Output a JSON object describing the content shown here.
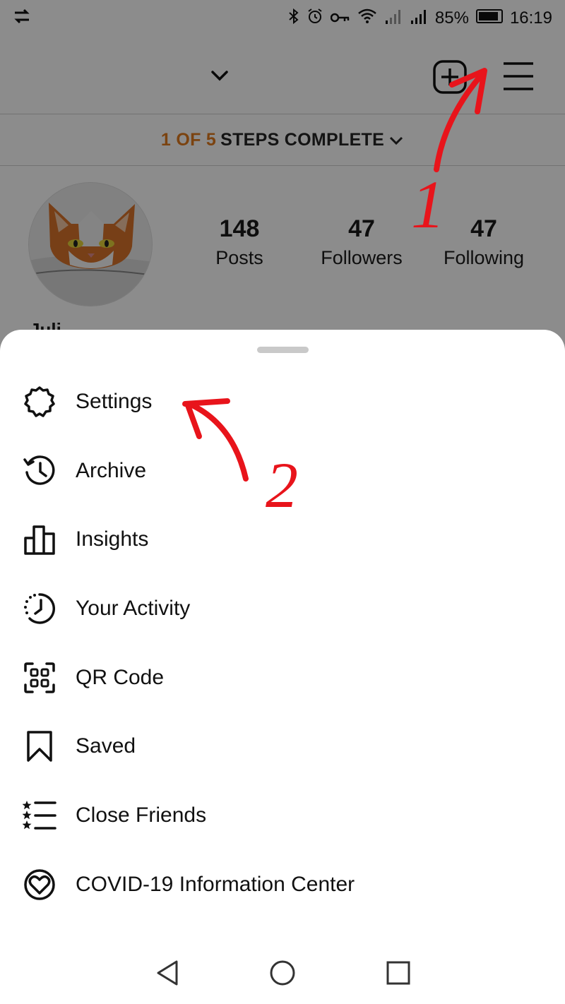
{
  "status_bar": {
    "battery": "85%",
    "time": "16:19"
  },
  "profile": {
    "steps_done": "1 OF 5",
    "steps_rest": "STEPS COMPLETE",
    "name_partial": "Juli",
    "stats": [
      {
        "value": "148",
        "label": "Posts"
      },
      {
        "value": "47",
        "label": "Followers"
      },
      {
        "value": "47",
        "label": "Following"
      }
    ]
  },
  "menu": {
    "items": [
      {
        "label": "Settings",
        "icon": "gear-icon"
      },
      {
        "label": "Archive",
        "icon": "archive-icon"
      },
      {
        "label": "Insights",
        "icon": "insights-icon"
      },
      {
        "label": "Your Activity",
        "icon": "activity-icon"
      },
      {
        "label": "QR Code",
        "icon": "qr-code-icon"
      },
      {
        "label": "Saved",
        "icon": "bookmark-icon"
      },
      {
        "label": "Close Friends",
        "icon": "close-friends-icon"
      },
      {
        "label": "COVID-19 Information Center",
        "icon": "covid-info-icon"
      }
    ]
  },
  "annotations": {
    "step1": "1",
    "step2": "2",
    "color": "#e8141b"
  },
  "colors": {
    "accent_orange": "#e07a1e",
    "overlay": "rgba(0,0,0,0.45)"
  }
}
